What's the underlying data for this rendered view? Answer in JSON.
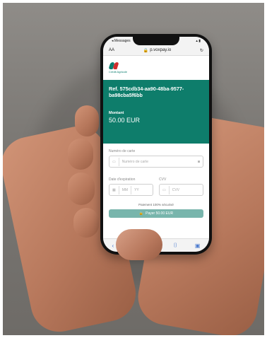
{
  "status_bar": {
    "left": "◂ Messages",
    "right": "▴ ▮"
  },
  "browser": {
    "text_size_label": "AA",
    "url": "p.voxpay.io",
    "reload_icon": "reload-icon"
  },
  "brand": {
    "logo_text": "Crédit Agricole"
  },
  "payment": {
    "reference": "Ref. 575cdb34-aa90-48ba-9577-ba98cba5f6bb",
    "amount_label": "Montant",
    "amount": "50.00 EUR"
  },
  "form": {
    "card_number_label": "Numéro de carte",
    "card_number_placeholder": "Numéro de carte",
    "expiry_label": "Date d'expiration",
    "expiry_month_placeholder": "MM",
    "expiry_year_placeholder": "YY",
    "cvv_label": "CVV",
    "cvv_placeholder": "CVV"
  },
  "footer": {
    "secure_text": "Paiement 100% sécurisé",
    "pay_button": "Payer 50.00 EUR"
  },
  "colors": {
    "brand_green": "#0e7d6b",
    "pay_button": "#78b5ac"
  }
}
